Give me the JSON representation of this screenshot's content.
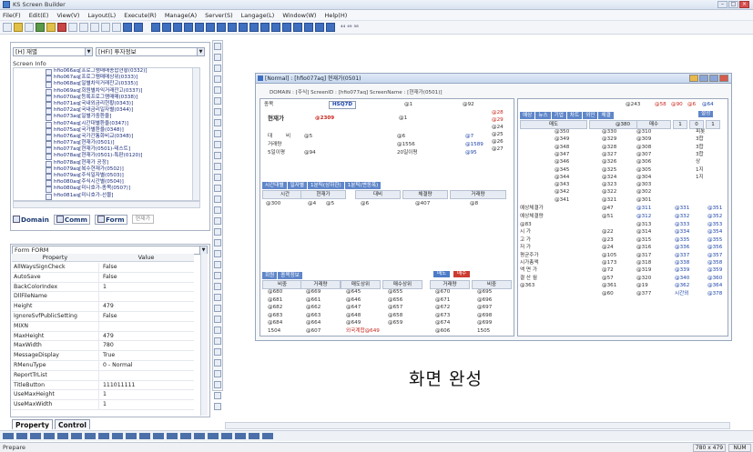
{
  "app": {
    "title": "KS Screen Builder"
  },
  "menu": [
    "File(F)",
    "Edit(E)",
    "View(V)",
    "Layout(L)",
    "Execute(R)",
    "Manage(A)",
    "Server(S)",
    "Langage(L)",
    "Window(W)",
    "Help(H)"
  ],
  "toolbar": {
    "index_label": "⁴⁴ ⁴⁹ ⁵⁸"
  },
  "explorer": {
    "combo_left": "[H] 재별",
    "combo_right": "[HFI] 투자정보",
    "label": "Screen Info",
    "tree": [
      "hfio066aq[프로그램매매종합현황(0332)]",
      "hfio067aq[프로그램매매상위(0333)]",
      "hfio068aq[일별차익거래잔고(0335)]",
      "hfio069aq[회원별차익거래잔고(0337)]",
      "hfio070aq[등록프로그램매매(0338)]",
      "hfio071aq[국내외금리현황(0343)]",
      "hfio072aq[국내금리일자별(0344)]",
      "hfio073aq[일별가중환율]",
      "hfio074aq[시간대별환율(0347)]",
      "hfio075aq[국가별환율(0348)]",
      "hfio076aq[국가간통화비교(0348)]",
      "hfio077aq[현재가(0501)]",
      "hfio077aq[현재가(0501)-테스트]",
      "hfio078aq[현재가(0501)-특판(0120)]",
      "hfio078aq[현재가 공정]",
      "hfio079aq[복수현재가(0502)]",
      "hfio079aq[주식일자별(0503)]",
      "hfio080aq[주식시간별(0504)]",
      "hfio080aq[미니호가-종목(0507)]",
      "hfio081aq[미니호가-선물]"
    ],
    "tabs": [
      "Domain",
      "Comm",
      "Form"
    ],
    "search_placeholder": "현재가"
  },
  "properties": {
    "combo": "Form FORM",
    "col_property": "Property",
    "col_value": "Value",
    "rows": [
      {
        "name": "AllWaysSignCheck",
        "value": "False"
      },
      {
        "name": "AutoSave",
        "value": "False"
      },
      {
        "name": "BackColorIndex",
        "value": "1"
      },
      {
        "name": "DllFileName",
        "value": ""
      },
      {
        "name": "Height",
        "value": "479"
      },
      {
        "name": "IgnoreSvfPublicSetting",
        "value": "False"
      },
      {
        "name": "MIXN",
        "value": ""
      },
      {
        "name": "MaxHeight",
        "value": "479"
      },
      {
        "name": "MaxWidth",
        "value": "780"
      },
      {
        "name": "MessageDisplay",
        "value": "True"
      },
      {
        "name": "RMenuType",
        "value": "0 - Normal"
      },
      {
        "name": "ReportTrList",
        "value": ""
      },
      {
        "name": "TitleButton",
        "value": "111011111"
      },
      {
        "name": "UseMaxHeight",
        "value": "1"
      },
      {
        "name": "UseMaxWidth",
        "value": "1"
      }
    ],
    "tabs": [
      "Property",
      "Control"
    ]
  },
  "form": {
    "title": "[Normal] : [hfio077aq] 현재가(0501)",
    "domain_line": "DOMAIN : [주식]  ScreenID : [hfio077aq]  ScreenName : [현재가(0501)]",
    "code_label": "종목",
    "code_value": "HSQ7D",
    "top_vals": [
      "@1",
      "@92",
      "@243",
      "@58",
      "@90",
      "@6",
      "@64",
      "@66"
    ],
    "top_button": "설정",
    "price_label": "현재가",
    "price_val": "@2309",
    "left_rows": [
      [
        "대",
        "비",
        "@5",
        "@6",
        "@7"
      ],
      [
        "거래량",
        "",
        "",
        "@1556",
        "@1589"
      ],
      [
        "5일이평",
        "",
        "@94",
        "20일이평",
        "@95"
      ]
    ],
    "right_col": [
      "@28",
      "@29",
      "@24",
      "@25",
      "@26",
      "@27"
    ],
    "time_tabs": [
      "시간대별",
      "일자별",
      "1분틱(상하한)",
      "1분틱(변동폭)"
    ],
    "time_head": [
      "시간",
      "현재가",
      "대비",
      "체결량",
      "거래량"
    ],
    "time_row": [
      "@300",
      "@4",
      "@5",
      "@6",
      "@407",
      "@8"
    ],
    "bottom_tabs": [
      "회원",
      "종목정보"
    ],
    "bottom_btns": [
      "매도",
      "매수"
    ],
    "bottom_head": [
      "비중",
      "거래량",
      "매도상위",
      "매수상위",
      "거래량",
      "비중"
    ],
    "bottom_rows": [
      [
        "@680",
        "@669",
        "@645",
        "@655",
        "@670",
        "@695"
      ],
      [
        "@681",
        "@661",
        "@646",
        "@656",
        "@671",
        "@696"
      ],
      [
        "@682",
        "@662",
        "@647",
        "@657",
        "@672",
        "@697"
      ],
      [
        "@683",
        "@663",
        "@648",
        "@658",
        "@673",
        "@698"
      ],
      [
        "@684",
        "@664",
        "@649",
        "@659",
        "@674",
        "@699"
      ],
      [
        "1504",
        "@607",
        "외국계합@649",
        "",
        "@606",
        "1505"
      ]
    ],
    "order_tabs": [
      "예상",
      "뉴스",
      "기업",
      "차트",
      "외인",
      "체결"
    ],
    "order_page": [
      "1",
      "0",
      "1"
    ],
    "order_head": [
      "매도",
      "@380",
      "매수"
    ],
    "order_rows": [
      [
        "@350",
        "@330",
        "@310"
      ],
      [
        "@349",
        "@329",
        "@309"
      ],
      [
        "@348",
        "@328",
        "@308"
      ],
      [
        "@347",
        "@327",
        "@307"
      ],
      [
        "@346",
        "@326",
        "@306"
      ],
      [
        "@345",
        "@325",
        "@305"
      ],
      [
        "@344",
        "@324",
        "@304"
      ],
      [
        "@343",
        "@323",
        "@303"
      ],
      [
        "@342",
        "@322",
        "@302"
      ],
      [
        "@341",
        "@321",
        "@301"
      ]
    ],
    "side_list": [
      "피봇",
      "3합",
      "3합",
      "3합",
      "상",
      "1지",
      "1지"
    ],
    "exp_rows": [
      [
        "예상체결가",
        "@47",
        "@311",
        "@331",
        "@351"
      ],
      [
        "예상체결량",
        "@51",
        "@312",
        "@332",
        "@352"
      ]
    ],
    "stat_rows": [
      [
        "@83",
        "",
        "@313",
        "@333",
        "@353"
      ],
      [
        "시 가",
        "@22",
        "@314",
        "@334",
        "@354"
      ],
      [
        "고 가",
        "@23",
        "@315",
        "@335",
        "@355"
      ],
      [
        "저 가",
        "@24",
        "@316",
        "@336",
        "@356"
      ],
      [
        "평균주가",
        "@105",
        "@317",
        "@337",
        "@357"
      ],
      [
        "시가총액",
        "@173",
        "@318",
        "@338",
        "@358"
      ],
      [
        "액 면 가",
        "@72",
        "@319",
        "@339",
        "@359"
      ],
      [
        "결 산 월",
        "@57",
        "@320",
        "@340",
        "@360"
      ],
      [
        "@363",
        "@361",
        "@19",
        "@362",
        "@364"
      ],
      [
        "",
        "@60",
        "@377",
        "시간외",
        "@378"
      ]
    ],
    "done_text": "화면 완성"
  },
  "status": {
    "text": "Prepare",
    "dims": "780 x 479",
    "mode": "NUM"
  }
}
